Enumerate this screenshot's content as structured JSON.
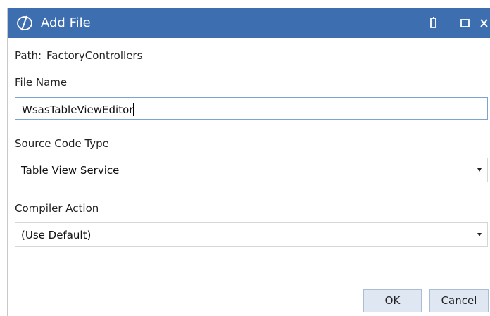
{
  "window": {
    "title": "Add File",
    "app_icon": "app-logo-icon",
    "controls": {
      "pin_icon": "pin-icon",
      "restore_icon": "restore-icon",
      "close_icon": "close-icon"
    },
    "titlebar_color": "#3d6fb0"
  },
  "path": {
    "label": "Path:",
    "value": "FactoryControllers"
  },
  "file_name": {
    "label": "File Name",
    "value": "WsasTableViewEditor"
  },
  "source_code_type": {
    "label": "Source Code Type",
    "selected": "Table View Service"
  },
  "compiler_action": {
    "label": "Compiler Action",
    "selected": "(Use Default)"
  },
  "buttons": {
    "ok": "OK",
    "cancel": "Cancel"
  }
}
